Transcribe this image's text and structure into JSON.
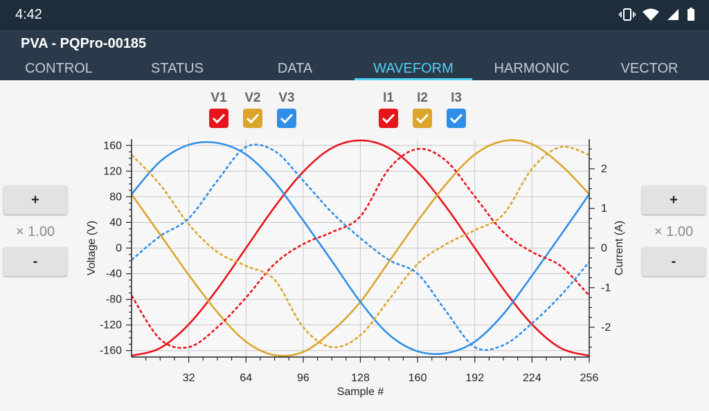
{
  "status_bar": {
    "time": "4:42"
  },
  "app": {
    "title": "PVA - PQPro-00185"
  },
  "tabs": [
    {
      "label": "CONTROL",
      "active": false
    },
    {
      "label": "STATUS",
      "active": false
    },
    {
      "label": "DATA",
      "active": false
    },
    {
      "label": "WAVEFORM",
      "active": true
    },
    {
      "label": "HARMONIC",
      "active": false
    },
    {
      "label": "VECTOR",
      "active": false
    }
  ],
  "left_scale": {
    "plus_label": "+",
    "value": "× 1.00",
    "minus_label": "-"
  },
  "right_scale": {
    "plus_label": "+",
    "value": "× 1.00",
    "minus_label": "-"
  },
  "checkboxes": [
    {
      "label": "V1",
      "color": "#e8141c",
      "checked": true
    },
    {
      "label": "V2",
      "color": "#dba52c",
      "checked": true
    },
    {
      "label": "V3",
      "color": "#2f8fe8",
      "checked": true
    },
    {
      "label": "I1",
      "color": "#e8141c",
      "checked": true
    },
    {
      "label": "I2",
      "color": "#dba52c",
      "checked": true
    },
    {
      "label": "I3",
      "color": "#2f8fe8",
      "checked": true
    }
  ],
  "chart_data": {
    "type": "line",
    "xlabel": "Sample #",
    "ylabel": "Voltage (V)",
    "y2label": "Current (A)",
    "xlim": [
      0,
      256
    ],
    "ylim": [
      -170,
      170
    ],
    "y2lim": [
      -2.75,
      2.75
    ],
    "xticks": [
      32,
      64,
      96,
      128,
      160,
      192,
      224,
      256
    ],
    "yticks": [
      160,
      120,
      80,
      40,
      0,
      -40,
      -80,
      -120,
      -160
    ],
    "y2ticks": [
      2,
      1,
      0,
      -1,
      -2
    ],
    "grid": true,
    "series": [
      {
        "name": "V1",
        "axis": "left",
        "style": "solid",
        "color": "#e8141c",
        "x": [
          0,
          16,
          32,
          48,
          64,
          80,
          96,
          112,
          128,
          144,
          160,
          176,
          192,
          208,
          224,
          240,
          256
        ],
        "y": [
          -168,
          -156,
          -119,
          -64,
          0,
          64,
          119,
          156,
          168,
          156,
          119,
          64,
          0,
          -64,
          -119,
          -156,
          -168
        ]
      },
      {
        "name": "V2",
        "axis": "left",
        "style": "solid",
        "color": "#dba52c",
        "x": [
          0,
          16,
          32,
          48,
          64,
          80,
          96,
          112,
          128,
          144,
          160,
          176,
          192,
          208,
          224,
          240,
          256
        ],
        "y": [
          84,
          21,
          -42,
          -100,
          -146,
          -167,
          -162,
          -130,
          -84,
          -21,
          42,
          100,
          146,
          167,
          162,
          130,
          84
        ]
      },
      {
        "name": "V3",
        "axis": "left",
        "style": "solid",
        "color": "#2f8fe8",
        "x": [
          0,
          16,
          32,
          48,
          64,
          80,
          96,
          112,
          128,
          144,
          160,
          176,
          192,
          208,
          224,
          240,
          256
        ],
        "y": [
          84,
          135,
          161,
          164,
          146,
          103,
          43,
          -20,
          -84,
          -135,
          -161,
          -164,
          -146,
          -103,
          -43,
          20,
          84
        ]
      },
      {
        "name": "I1",
        "axis": "right",
        "style": "dashed",
        "color": "#e8141c",
        "x": [
          0,
          16,
          32,
          48,
          64,
          80,
          96,
          112,
          128,
          144,
          160,
          176,
          192,
          208,
          224,
          240,
          256
        ],
        "y": [
          -1.2,
          -2.3,
          -2.5,
          -2.0,
          -1.25,
          -0.4,
          0.1,
          0.4,
          0.8,
          2.0,
          2.5,
          2.2,
          1.3,
          0.4,
          -0.1,
          -0.45,
          -1.2
        ]
      },
      {
        "name": "I2",
        "axis": "right",
        "style": "dashed",
        "color": "#dba52c",
        "x": [
          0,
          16,
          32,
          48,
          64,
          80,
          96,
          112,
          128,
          144,
          160,
          176,
          192,
          208,
          224,
          240,
          256
        ],
        "y": [
          2.35,
          1.6,
          0.6,
          -0.1,
          -0.45,
          -0.8,
          -2.0,
          -2.5,
          -2.2,
          -1.3,
          -0.4,
          0.1,
          0.45,
          0.85,
          2.0,
          2.55,
          2.35
        ]
      },
      {
        "name": "I3",
        "axis": "right",
        "style": "dashed",
        "color": "#2f8fe8",
        "x": [
          0,
          16,
          32,
          48,
          64,
          80,
          96,
          112,
          128,
          144,
          160,
          176,
          192,
          208,
          224,
          240,
          256
        ],
        "y": [
          -0.3,
          0.3,
          0.75,
          1.7,
          2.55,
          2.45,
          1.7,
          0.9,
          0.25,
          -0.3,
          -0.65,
          -1.6,
          -2.5,
          -2.45,
          -1.9,
          -1.2,
          -0.35
        ]
      }
    ]
  }
}
